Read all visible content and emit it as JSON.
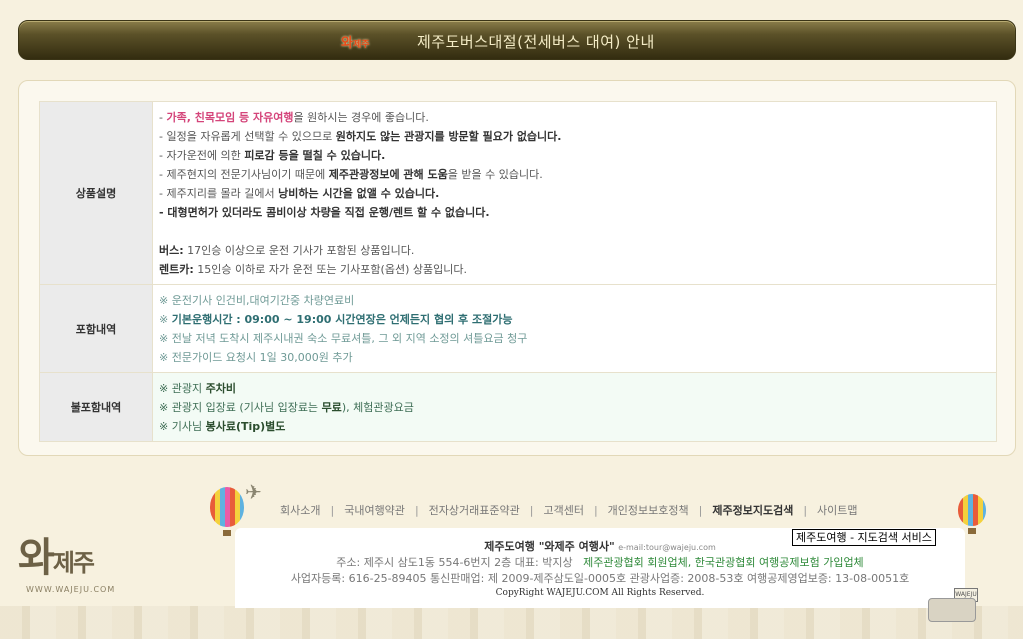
{
  "header": {
    "logo_main": "와",
    "logo_sub": "제주",
    "title": "제주도버스대절(전세버스 대여) 안내"
  },
  "table": {
    "rows": [
      {
        "label": "상품설명",
        "lines": [
          {
            "a": "- ",
            "b": "가족, 친목모임 등 자유여행",
            "c": "을 원하시는 경우에 좋습니다."
          },
          {
            "a": "- 일정을 자유롭게 선택할 수 있으므로 ",
            "b": "원하지도 않는 관광지를 방문할 필요가 없습니다."
          },
          {
            "a": "- 자가운전에 의한 ",
            "b": "피로감 등을 떨칠 수 있습니다."
          },
          {
            "a": "- 제주현지의 전문기사님이기 때문에 ",
            "b": "제주관광정보에 관해 도움",
            "c": "을 받을 수 있습니다."
          },
          {
            "a": "- 제주지리를 몰라 길에서 ",
            "b": "낭비하는 시간을 없앨 수 있습니다."
          },
          {
            "b": "- 대형면허가 있더라도 콤비이상 차량을 직접 운행/렌트 할 수 없습니다."
          }
        ],
        "notes": [
          {
            "label": "버스:",
            "text": " 17인승 이상으로 운전 기사가 포함된 상품입니다."
          },
          {
            "label": "렌트카:",
            "text": " 15인승 이하로 자가 운전 또는 기사포함(옵션) 상품입니다."
          }
        ]
      },
      {
        "label": "포함내역",
        "lines": [
          {
            "a": "※ 운전기사 인건비,대여기간중 차량연료비"
          },
          {
            "a": "※ ",
            "b": "기본운행시간 : 09:00 ~ 19:00 시간연장은 언제든지 협의 후 조절가능"
          },
          {
            "a": "※ 전날 저녁 도착시 제주시내권 숙소 무료셔틀, 그 외 지역 소정의 셔틀요금 청구"
          },
          {
            "a": "※ 전문가이드 요청시 1일 30,000원 추가"
          }
        ]
      },
      {
        "label": "불포함내역",
        "lines": [
          {
            "a": "※ 관광지 ",
            "b": "주차비"
          },
          {
            "a": "※ 관광지 입장료 (기사님 입장료는 ",
            "b": "무료",
            "c": "), 체험관광요금"
          },
          {
            "a": "※ 기사님 ",
            "b": "봉사료(Tip)별도"
          }
        ]
      }
    ]
  },
  "footer": {
    "brand_main": "와",
    "brand_sub": "제주",
    "brand_url": "WWW.WAJEJU.COM",
    "nav": [
      {
        "label": "회사소개",
        "active": false
      },
      {
        "label": "국내여행약관",
        "active": false
      },
      {
        "label": "전자상거래표준약관",
        "active": false
      },
      {
        "label": "고객센터",
        "active": false
      },
      {
        "label": "개인정보보호정책",
        "active": false
      },
      {
        "label": "제주정보지도검색",
        "active": true
      },
      {
        "label": "사이트맵",
        "active": false
      }
    ],
    "nav_separator": "|",
    "tooltip": "제주도여행 - 지도검색 서비스",
    "company_prefix": "제주도여행 ",
    "company_name": "\"와제주 여행사\"",
    "email": "e-mail:tour@wajeju.com",
    "address": "주소: 제주시 삼도1동 554-6번지 2층 대표: 박지상",
    "associations": "제주관광협회 회원업체, 한국관광협회 여행공제보험 가입업체",
    "registration": "사업자등록: 616-25-89405 통신판매업: 제 2009-제주삼도일-0005호  관광사업증: 2008-53호  여행공제영업보증: 13-08-0051호",
    "copyright": "CopyRight WAJEJU.COM All Rights Reserved.",
    "bus_sign": "WAJEJU"
  }
}
